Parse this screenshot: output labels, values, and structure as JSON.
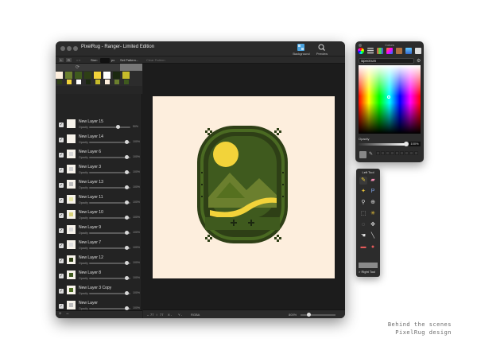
{
  "main_window": {
    "title": "PixelRug - Ranger- Limited Edition",
    "toolbar": {
      "background_label": "Background",
      "preview_label": "Preview"
    },
    "options_bar": {
      "l": "L",
      "r": "R",
      "size_label": "Size:",
      "size_unit": "px",
      "pattern_label": "Set Pattern...",
      "clear_label": "Clear Pattern"
    },
    "palette_colors": [
      "#fdeedd",
      "#6b7f2e",
      "#3f5a1e",
      "#2e3f16",
      "#f2d33a",
      "#ffffff",
      "#1b2810",
      "#c7bb2a"
    ],
    "layers": [
      {
        "name": "New Layer 15",
        "opacity_label": "Opacity",
        "pct": "50%",
        "knob": 0.7,
        "mark": ""
      },
      {
        "name": "New Layer 14",
        "opacity_label": "Opacity",
        "pct": "100%",
        "knob": 0.92,
        "mark": ""
      },
      {
        "name": "New Layer 6",
        "opacity_label": "Opacity",
        "pct": "100%",
        "knob": 0.92,
        "mark": "#d8d8d8"
      },
      {
        "name": "New Layer 3",
        "opacity_label": "Opacity",
        "pct": "100%",
        "knob": 0.92,
        "mark": "#cfcfcf"
      },
      {
        "name": "New Layer 13",
        "opacity_label": "Opacity",
        "pct": "100%",
        "knob": 0.92,
        "mark": "#bcbcbc"
      },
      {
        "name": "New Layer 11",
        "opacity_label": "Opacity",
        "pct": "100%",
        "knob": 0.92,
        "mark": "#e6e6a8"
      },
      {
        "name": "New Layer 10",
        "opacity_label": "Opacity",
        "pct": "100%",
        "knob": 0.92,
        "mark": "#d8d27a"
      },
      {
        "name": "New Layer 9",
        "opacity_label": "Opacity",
        "pct": "100%",
        "knob": 0.92,
        "mark": "#d8d8d8"
      },
      {
        "name": "New Layer 7",
        "opacity_label": "Opacity",
        "pct": "100%",
        "knob": 0.92,
        "mark": "#e0e0e0"
      },
      {
        "name": "New Layer 12",
        "opacity_label": "Opacity",
        "pct": "100%",
        "knob": 0.92,
        "mark": "#2e3f16"
      },
      {
        "name": "New Layer 8",
        "opacity_label": "Opacity",
        "pct": "100%",
        "knob": 0.92,
        "mark": "#3f5a1e"
      },
      {
        "name": "New Layer 3 Copy",
        "opacity_label": "Opacity",
        "pct": "100%",
        "knob": 0.92,
        "mark": "#4a6a22"
      },
      {
        "name": "New Layer",
        "opacity_label": "Opacity",
        "pct": "100%",
        "knob": 0.92,
        "mark": "#bdbdbd"
      },
      {
        "name": "New Layer Copy",
        "opacity_label": "Opacity",
        "pct": "100%",
        "knob": 0.92,
        "mark": "#35501a"
      }
    ],
    "status": {
      "w": "77",
      "h": "77",
      "x_label": "X -",
      "y_label": "Y -",
      "mode": "RGBA",
      "zoom": "800%"
    }
  },
  "colors_window": {
    "title": "Colors",
    "mode": "Spectrum",
    "opacity_label": "Opacity",
    "opacity_value": "100%"
  },
  "tool_window": {
    "left_label": "Left Tool",
    "right_label": "> Right Tool"
  },
  "caption": {
    "line1": "Behind the scenes",
    "line2": "PixelRug design"
  },
  "colors": {
    "canvas_bg": "#fdeedd",
    "badge_dark": "#2e3f16",
    "badge_mid": "#3f5a1e",
    "badge_light": "#6b7f2e",
    "badge_yellow": "#f2d33a"
  }
}
